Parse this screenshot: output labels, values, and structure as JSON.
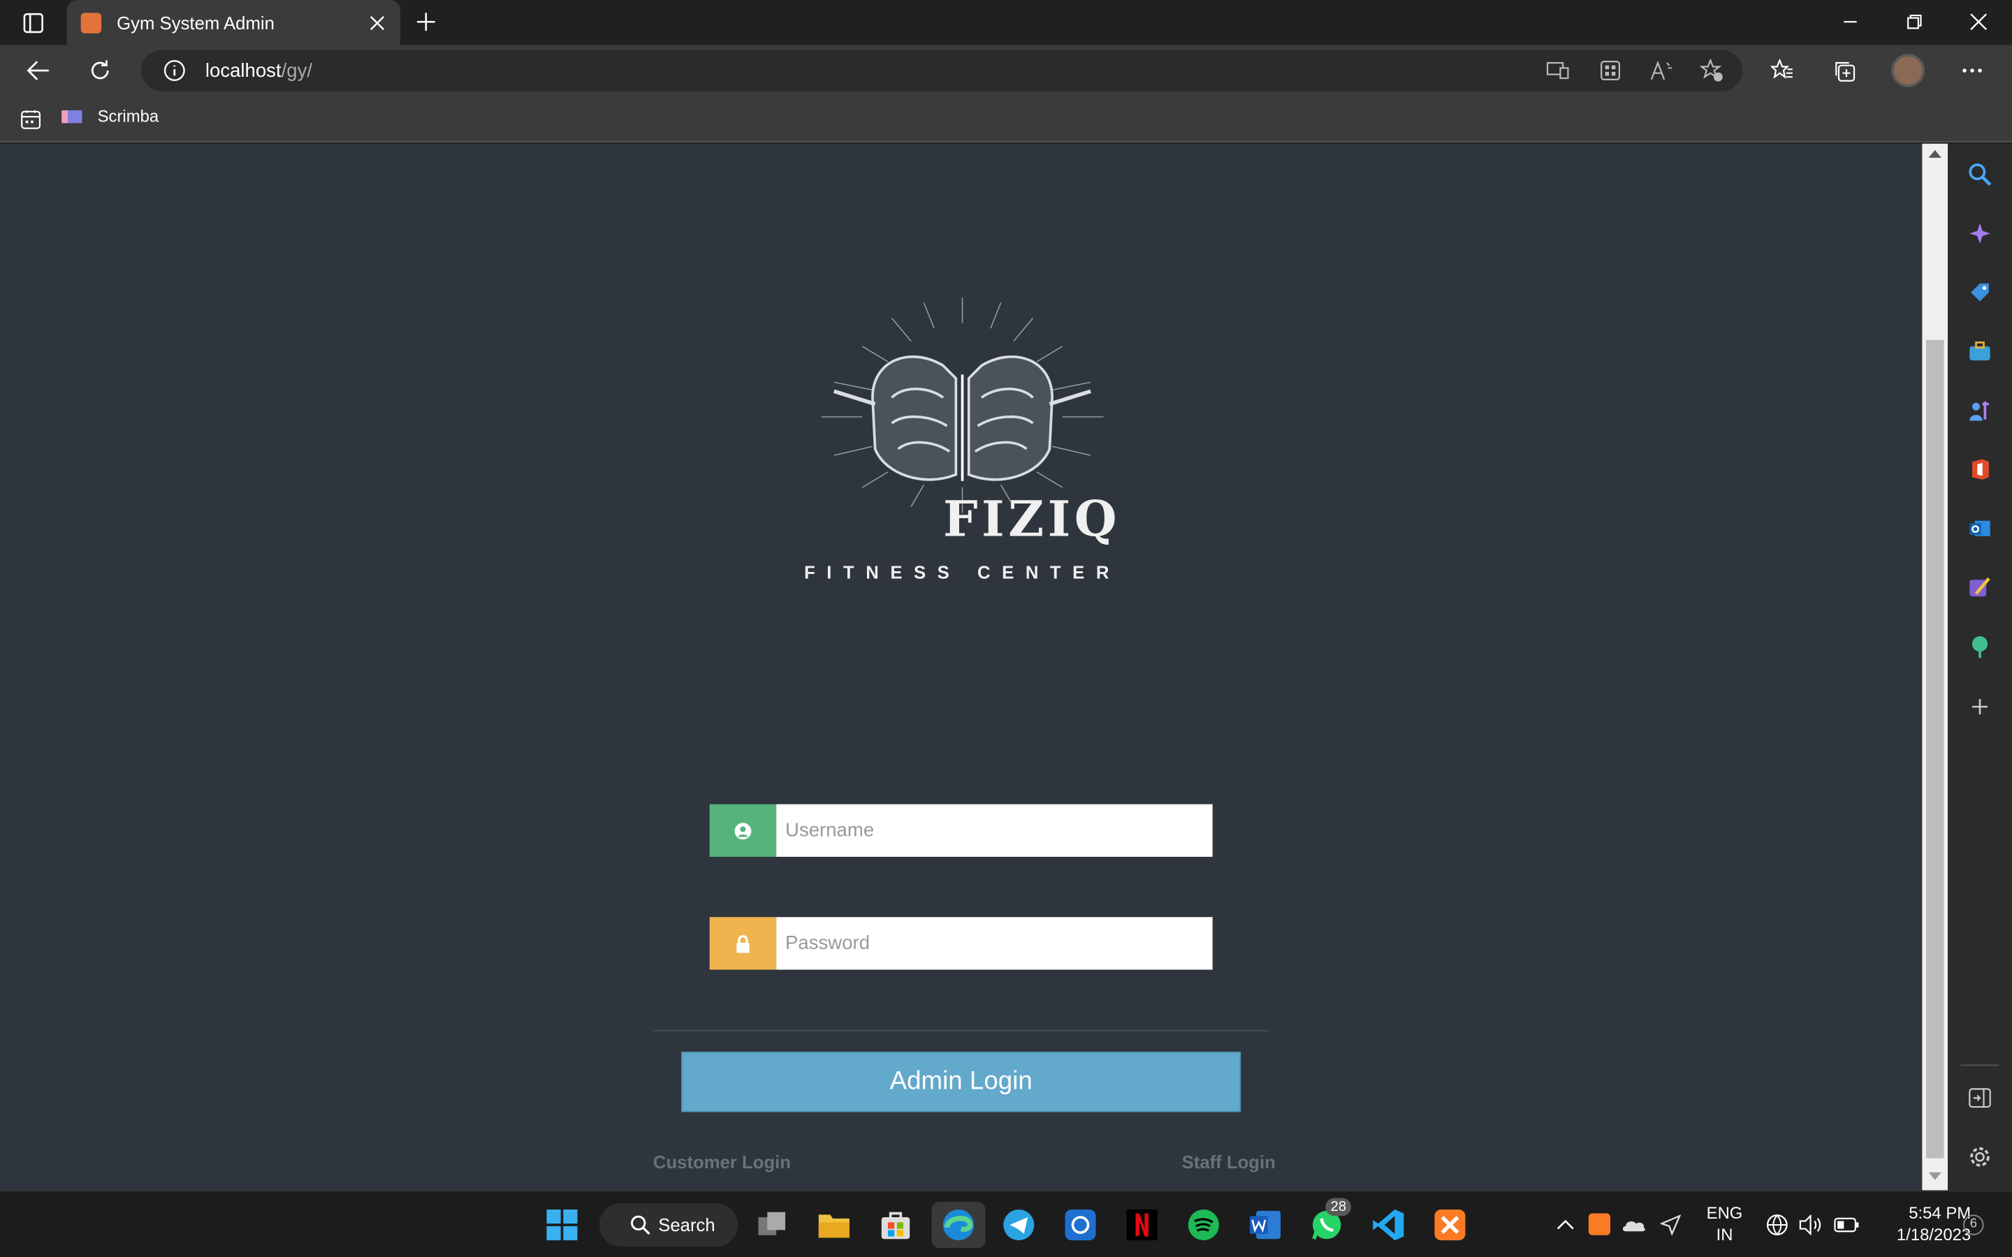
{
  "browser": {
    "tab_title": "Gym System Admin",
    "url_host": "localhost",
    "url_path": "/gy/",
    "bookmark": "Scrimba"
  },
  "brand": {
    "name": "FIZIQ",
    "subtitle": "FITNESS CENTER"
  },
  "form": {
    "username_placeholder": "Username",
    "password_placeholder": "Password",
    "login_label": "Admin Login",
    "customer_link": "Customer Login",
    "staff_link": "Staff Login"
  },
  "taskbar": {
    "search_label": "Search",
    "whatsapp_badge": "28",
    "lang1": "ENG",
    "lang2": "IN",
    "time": "5:54 PM",
    "date": "1/18/2023",
    "notif": "6"
  },
  "colors": {
    "page_bg": "#2f353d",
    "username_addon": "#54b47b",
    "password_addon": "#f0b44f",
    "login_button": "#63a9cb"
  }
}
